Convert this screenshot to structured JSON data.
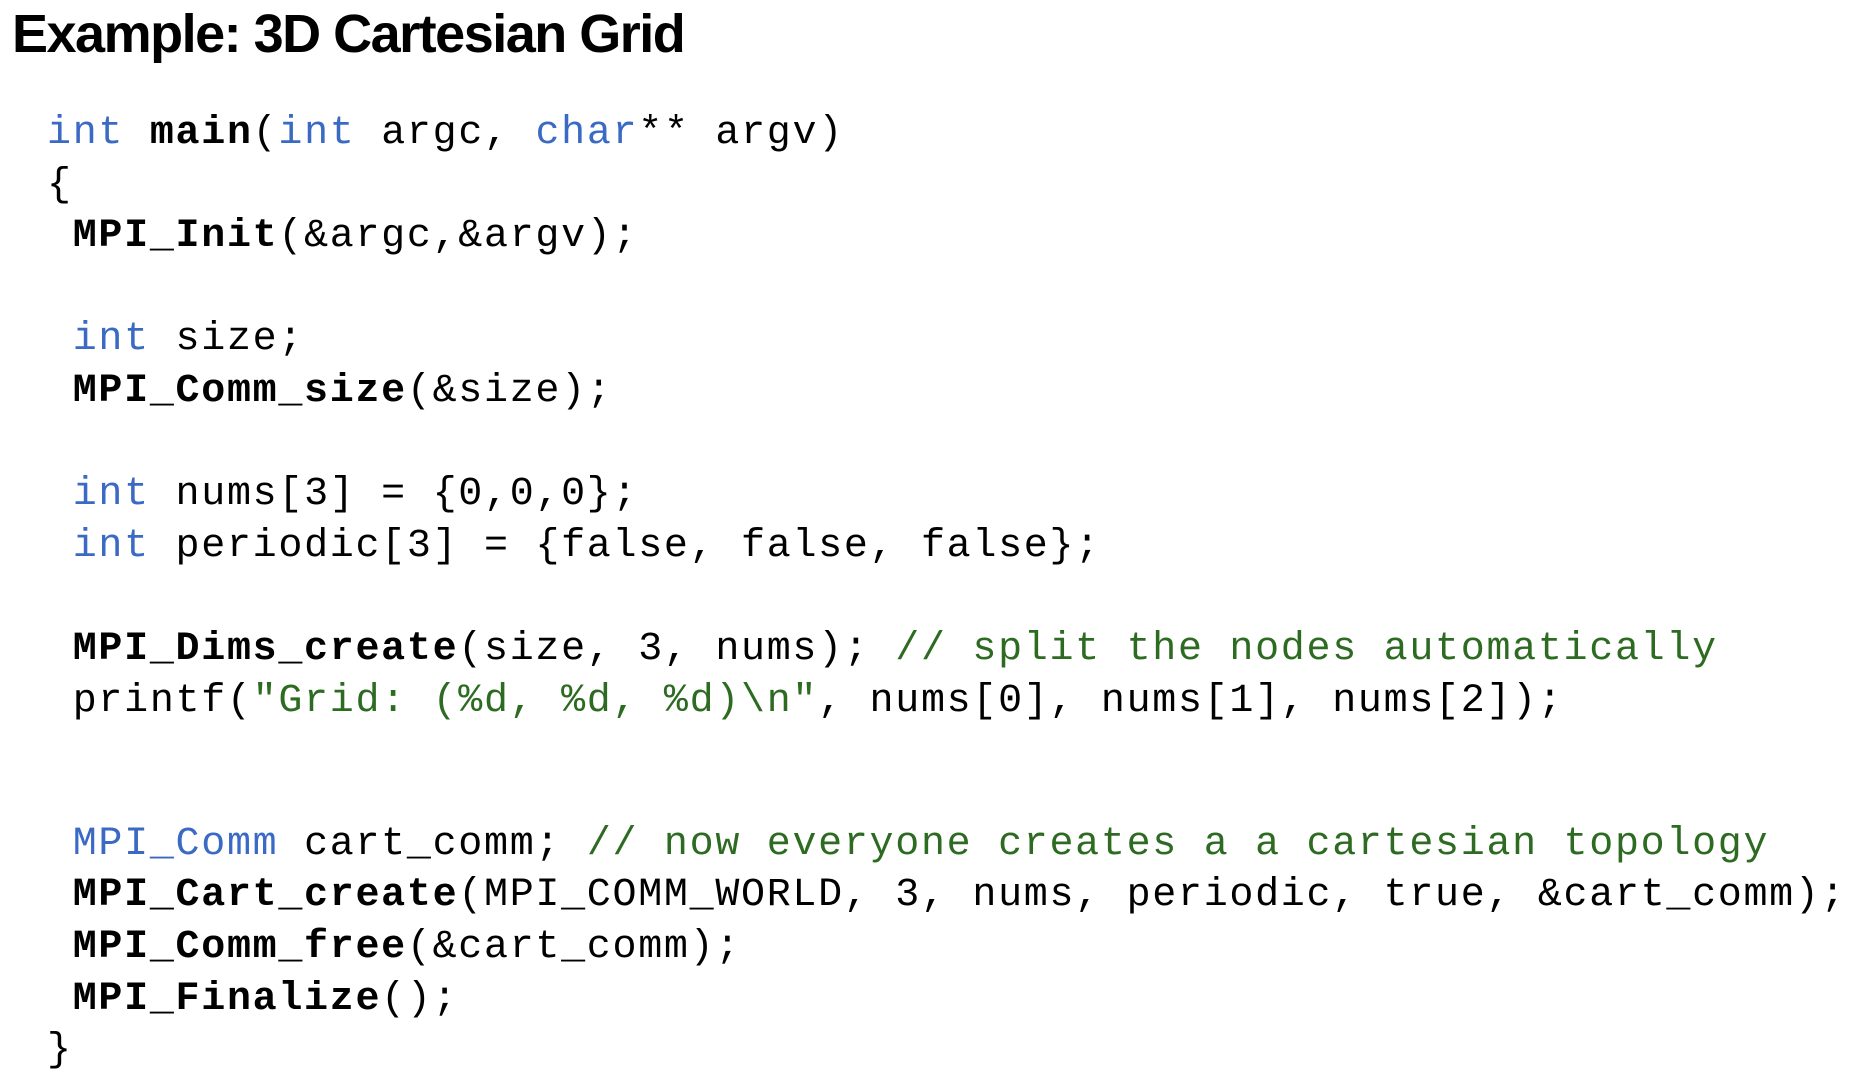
{
  "title": "Example: 3D Cartesian Grid",
  "colors": {
    "keyword": "#3b6ac4",
    "comment": "#2e6b22",
    "text": "#000000"
  },
  "code_lines": [
    [
      {
        "t": "int",
        "s": "kw"
      },
      {
        "t": " "
      },
      {
        "t": "main",
        "s": "fn"
      },
      {
        "t": "("
      },
      {
        "t": "int",
        "s": "kw"
      },
      {
        "t": " argc, "
      },
      {
        "t": "char",
        "s": "kw"
      },
      {
        "t": "** argv)"
      }
    ],
    [
      {
        "t": "{"
      }
    ],
    [
      {
        "t": " "
      },
      {
        "t": "MPI_Init",
        "s": "fn"
      },
      {
        "t": "(&argc,&argv);"
      }
    ],
    [],
    [
      {
        "t": " "
      },
      {
        "t": "int",
        "s": "kw"
      },
      {
        "t": " size;"
      }
    ],
    [
      {
        "t": " "
      },
      {
        "t": "MPI_Comm_size",
        "s": "fn"
      },
      {
        "t": "(&size);"
      }
    ],
    [],
    [
      {
        "t": " "
      },
      {
        "t": "int",
        "s": "kw"
      },
      {
        "t": " nums[3] = {0,0,0};"
      }
    ],
    [
      {
        "t": " "
      },
      {
        "t": "int",
        "s": "kw"
      },
      {
        "t": " periodic[3] = {false, false, false};"
      }
    ],
    [],
    [
      {
        "t": " "
      },
      {
        "t": "MPI_Dims_create",
        "s": "fn"
      },
      {
        "t": "(size, 3, nums); "
      },
      {
        "t": "// split the nodes automatically",
        "s": "cm"
      }
    ],
    [
      {
        "t": " printf("
      },
      {
        "t": "\"Grid: (%d, %d, %d)\\n\"",
        "s": "str"
      },
      {
        "t": ", nums[0], nums[1], nums[2]);"
      }
    ],
    [],
    [
      {
        "t": " "
      },
      {
        "t": "MPI_Comm",
        "s": "kw"
      },
      {
        "t": " cart_comm; "
      },
      {
        "t": "// now everyone creates a a cartesian topology",
        "s": "cm"
      }
    ],
    [
      {
        "t": " "
      },
      {
        "t": "MPI_Cart_create",
        "s": "fn"
      },
      {
        "t": "(MPI_COMM_WORLD, 3, nums, periodic, true, &cart_comm);"
      }
    ],
    [
      {
        "t": " "
      },
      {
        "t": "MPI_Comm_free",
        "s": "fn"
      },
      {
        "t": "(&cart_comm);"
      }
    ],
    [
      {
        "t": " "
      },
      {
        "t": "MPI_Finalize",
        "s": "fn"
      },
      {
        "t": "();"
      }
    ],
    [
      {
        "t": "}"
      }
    ]
  ]
}
